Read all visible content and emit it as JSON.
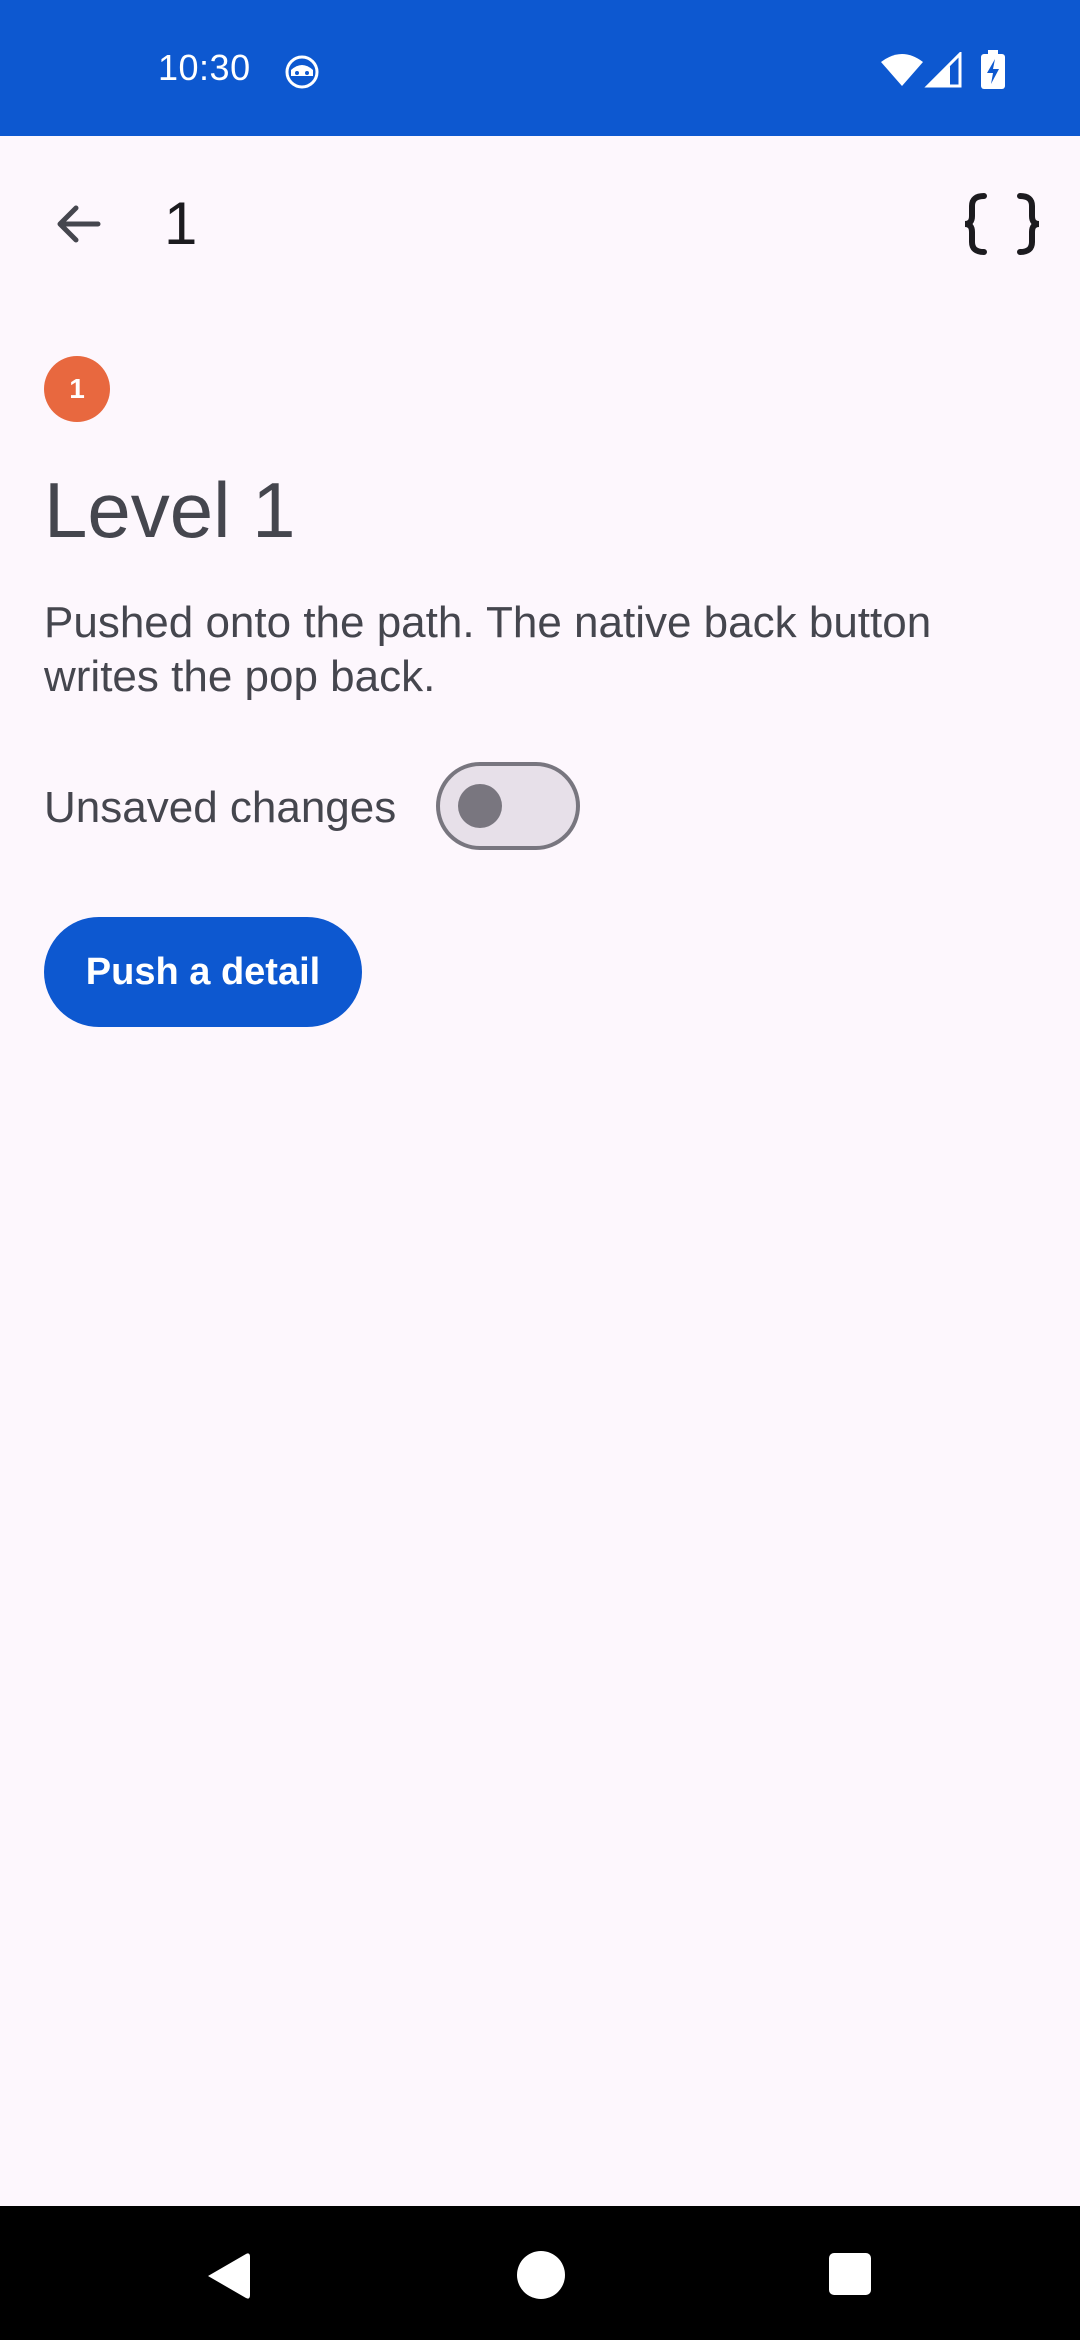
{
  "status_bar": {
    "time": "10:30",
    "icons": [
      "app-notification-icon",
      "wifi-icon",
      "cell-signal-icon",
      "battery-charging-icon"
    ]
  },
  "app_bar": {
    "title": "1",
    "back_icon": "arrow-back-icon",
    "action_icon": "code-braces-icon"
  },
  "content": {
    "badge": "1",
    "heading": "Level 1",
    "description": "Pushed onto the path. The native back button writes the pop back.",
    "toggle_label": "Unsaved changes",
    "toggle_on": false,
    "push_button": "Push a detail"
  },
  "nav_bar": {
    "icons": [
      "nav-back-icon",
      "nav-home-icon",
      "nav-recents-icon"
    ]
  },
  "colors": {
    "primary": "#0d58d0",
    "background": "#fdf7fd",
    "badge": "#e8683f",
    "text": "#45464e"
  }
}
